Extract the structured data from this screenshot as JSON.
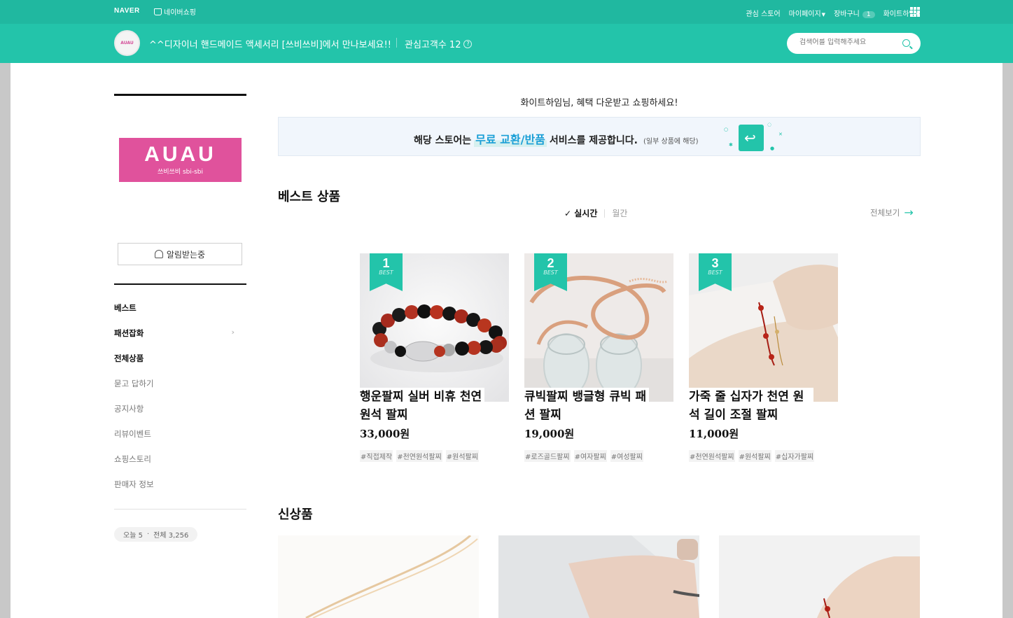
{
  "header": {
    "naver_logo": "NAVER",
    "shopping_link": "네이버쇼핑",
    "menu": {
      "interest_store": "관심 스토어",
      "mypage": "마이페이지",
      "cart": "장바구니",
      "cart_count": "1",
      "user": "화이트하임"
    },
    "avatar_text": "AUAU",
    "store_title": "^^디자이너 핸드메이드 액세서리 [쓰비쓰비]에서 만나보세요!!",
    "fans_label": "관심고객수 12",
    "help": "?",
    "search_placeholder": "검색어를 입력해주세요"
  },
  "sidebar": {
    "logo_main": "AUAU",
    "logo_sub": "쓰비쓰비 sbi-sbi",
    "notify_label": "알림받는중",
    "nav": [
      {
        "label": "베스트"
      },
      {
        "label": "패션잡화",
        "arrow": "›"
      },
      {
        "label": "전체상품"
      },
      {
        "label": "묻고 답하기"
      },
      {
        "label": "공지사항"
      },
      {
        "label": "리뷰이벤트"
      },
      {
        "label": "쇼핑스토리"
      },
      {
        "label": "판매자 정보"
      }
    ],
    "visits": {
      "today": "오늘 5",
      "dot": "·",
      "total": "전체 3,256"
    }
  },
  "main": {
    "greeting": "화이트하임님, 혜택 다운받고 쇼핑하세요!",
    "benefit": {
      "prefix": "해당 스토어는",
      "highlight": "무료 교환/반품",
      "suffix": "서비스를 제공합니다.",
      "note": "(일부 상품에 해당)"
    },
    "best_title": "베스트 상품",
    "tabs": {
      "realtime": "실시간",
      "monthly": "월간"
    },
    "view_all": "전체보기",
    "products": [
      {
        "rank": "1",
        "best": "BEST",
        "name": "행운팔찌 실버 비휴 천연원석 팔찌",
        "price": "33,000원",
        "tags": [
          "#직접제작",
          "#천연원석팔찌",
          "#원석팔찌"
        ]
      },
      {
        "rank": "2",
        "best": "BEST",
        "name": "큐빅팔찌 뱅글형 큐빅 패션 팔찌",
        "price": "19,000원",
        "tags": [
          "#로즈골드팔찌",
          "#여자팔찌",
          "#여성팔찌"
        ]
      },
      {
        "rank": "3",
        "best": "BEST",
        "name": "가죽 줄 십자가 천연 원석 길이 조절 팔찌",
        "price": "11,000원",
        "tags": [
          "#천연원석팔찌",
          "#원석팔찌",
          "#십자가팔찌"
        ]
      }
    ],
    "new_title": "신상품"
  }
}
